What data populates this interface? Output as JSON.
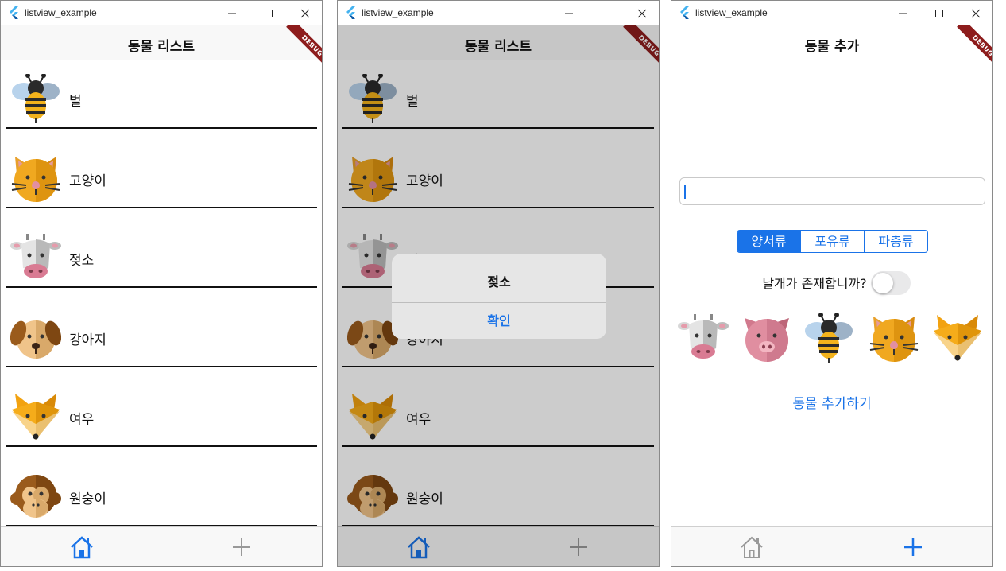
{
  "window_title": "listview_example",
  "accent": "#1a73e8",
  "list_screen": {
    "app_title": "동물 리스트",
    "debug_banner": "DEBUG",
    "animals": [
      {
        "name": "벌",
        "icon": "bee-icon"
      },
      {
        "name": "고양이",
        "icon": "cat-icon"
      },
      {
        "name": "젖소",
        "icon": "cow-icon"
      },
      {
        "name": "강아지",
        "icon": "dog-icon"
      },
      {
        "name": "여우",
        "icon": "fox-icon"
      },
      {
        "name": "원숭이",
        "icon": "monkey-icon"
      }
    ]
  },
  "dialog": {
    "title": "젖소",
    "confirm_label": "확인"
  },
  "add_screen": {
    "app_title": "동물 추가",
    "name_input_value": "",
    "segments": [
      "양서류",
      "포유류",
      "파충류"
    ],
    "selected_segment": "양서류",
    "wings_question": "날개가 존재합니까?",
    "wings_toggle_on": false,
    "choices": [
      "cow-icon",
      "pig-icon",
      "bee-icon",
      "cat-icon",
      "fox-icon"
    ],
    "add_button_label": "동물 추가하기"
  },
  "bottom_nav": {
    "home": "home-icon",
    "add": "plus-icon",
    "active_first_two": "home",
    "active_third": "add"
  }
}
